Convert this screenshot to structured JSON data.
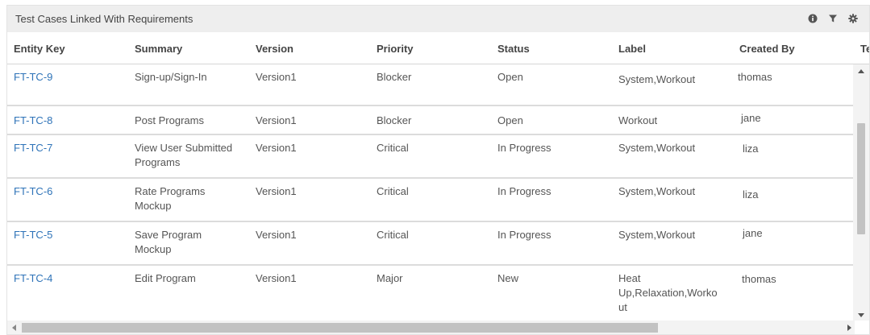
{
  "panel": {
    "title": "Test Cases Linked With Requirements",
    "icons": [
      "info-icon",
      "filter-icon",
      "gear-icon"
    ]
  },
  "columns": [
    "Entity Key",
    "Summary",
    "Version",
    "Priority",
    "Status",
    "Label",
    "Created By",
    "Te"
  ],
  "rows": [
    {
      "key": "FT-TC-9",
      "summary": "Sign-up/Sign-In",
      "version": "Version1",
      "priority": "Blocker",
      "status": "Open",
      "label": "System,Workout",
      "created_by": "thomas"
    },
    {
      "key": "FT-TC-8",
      "summary": "Post Programs",
      "version": "Version1",
      "priority": "Blocker",
      "status": "Open",
      "label": "Workout",
      "created_by": "jane"
    },
    {
      "key": "FT-TC-7",
      "summary": "View User Submitted\nPrograms",
      "version": "Version1",
      "priority": "Critical",
      "status": "In Progress",
      "label": "System,Workout",
      "created_by": "liza"
    },
    {
      "key": "FT-TC-6",
      "summary": "Rate Programs\nMockup",
      "version": "Version1",
      "priority": "Critical",
      "status": "In Progress",
      "label": "System,Workout",
      "created_by": "liza"
    },
    {
      "key": "FT-TC-5",
      "summary": "Save Program\nMockup",
      "version": "Version1",
      "priority": "Critical",
      "status": "In Progress",
      "label": "System,Workout",
      "created_by": "jane"
    },
    {
      "key": "FT-TC-4",
      "summary": "Edit Program",
      "version": "Version1",
      "priority": "Major",
      "status": "New",
      "label": "Heat\nUp,Relaxation,Worko\nut",
      "created_by": "thomas"
    }
  ]
}
